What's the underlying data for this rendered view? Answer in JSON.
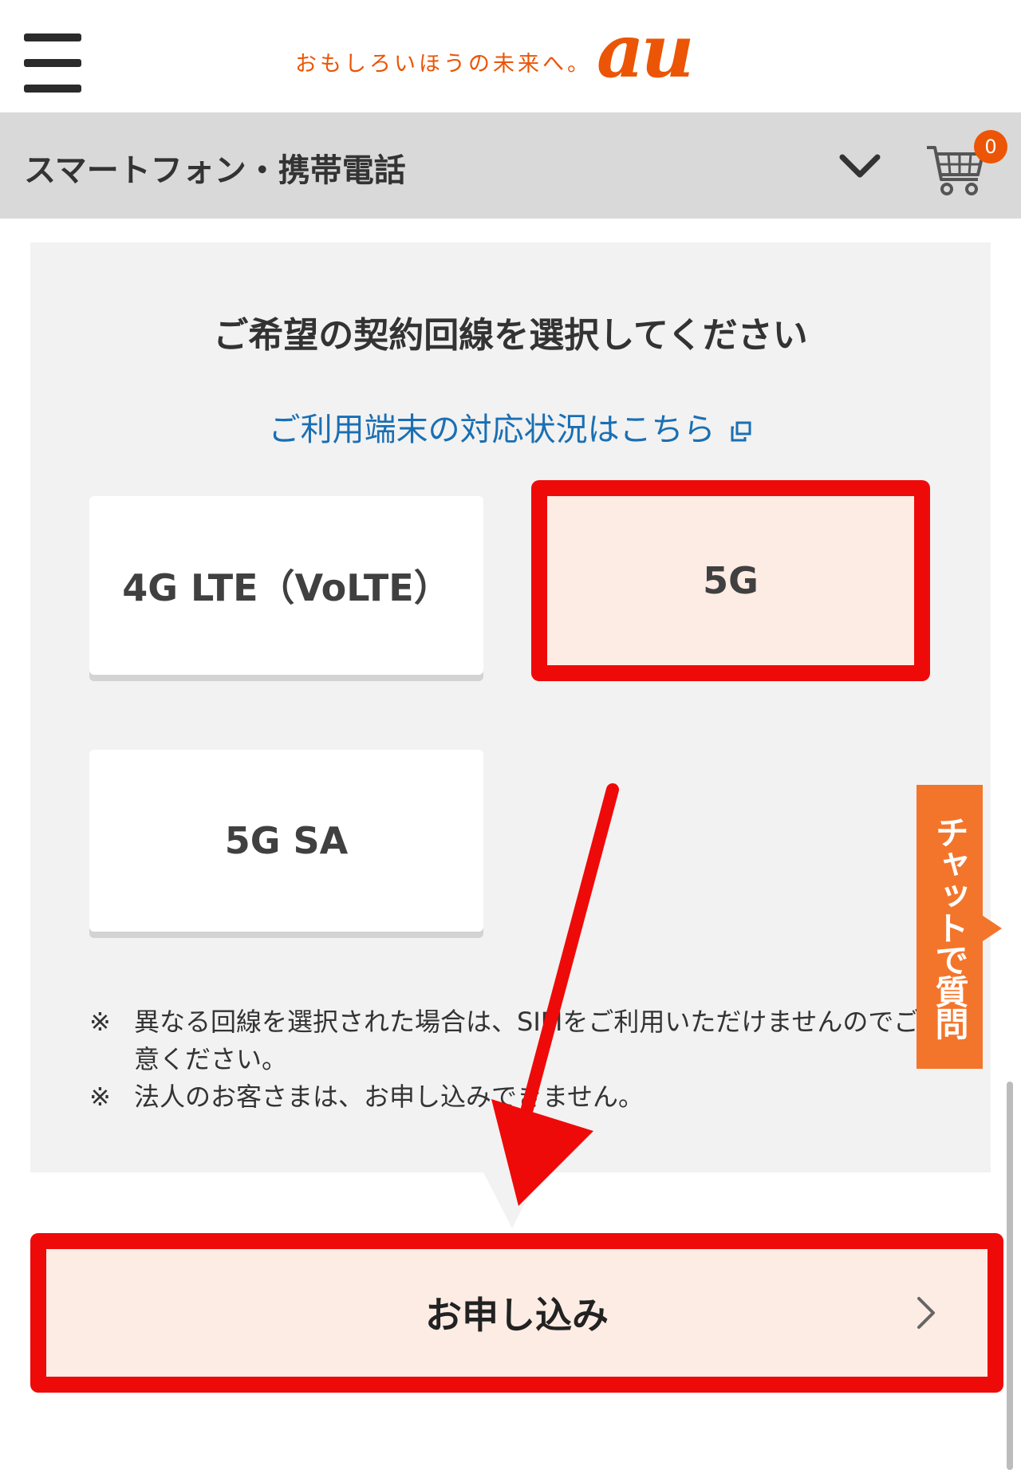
{
  "header": {
    "tagline": "おもしろいほうの未来へ。",
    "brand": "au"
  },
  "category_bar": {
    "title": "スマートフォン・携帯電話",
    "cart_count": "0"
  },
  "panel": {
    "heading": "ご希望の契約回線を選択してください",
    "compat_link": "ご利用端末の対応状況はこちら",
    "options": [
      {
        "label": "4G LTE（VoLTE）",
        "selected": false
      },
      {
        "label": "5G",
        "selected": true
      },
      {
        "label": "5G SA",
        "selected": false
      }
    ],
    "notes": [
      {
        "mark": "※",
        "text": "異なる回線を選択された場合は、SIMをご利用いただけませんのでご注意ください。"
      },
      {
        "mark": "※",
        "text": "法人のお客さまは、お申し込みできません。"
      }
    ]
  },
  "chat": {
    "label": "チャットで質問"
  },
  "apply_button": {
    "label": "お申し込み"
  },
  "colors": {
    "brand_orange": "#eb5505",
    "highlight_red": "#ef0a0a",
    "link_blue": "#1a6fb3",
    "selected_bg": "#fdece4",
    "chat_orange": "#f3752b"
  }
}
